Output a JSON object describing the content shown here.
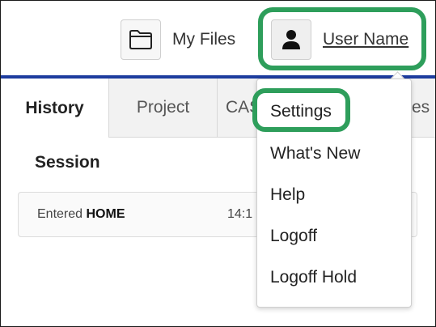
{
  "header": {
    "my_files_label": "My Files",
    "user_label": "User Name",
    "icons": {
      "my_files": "folder-icon",
      "user": "user-icon"
    }
  },
  "tabs": [
    {
      "label": "History",
      "active": true
    },
    {
      "label": "Project",
      "active": false
    },
    {
      "label": "CAS",
      "active": false
    },
    {
      "label": "es",
      "active": false
    }
  ],
  "history": {
    "section_title": "Session",
    "rows": [
      {
        "prefix": "Entered",
        "target": "HOME",
        "time": "14:1"
      }
    ]
  },
  "user_menu": {
    "items": [
      "Settings",
      "What's New",
      "Help",
      "Logoff",
      "Logoff Hold"
    ]
  },
  "colors": {
    "accent_bar": "#1d3c9e",
    "highlight": "#2e9e5b"
  }
}
